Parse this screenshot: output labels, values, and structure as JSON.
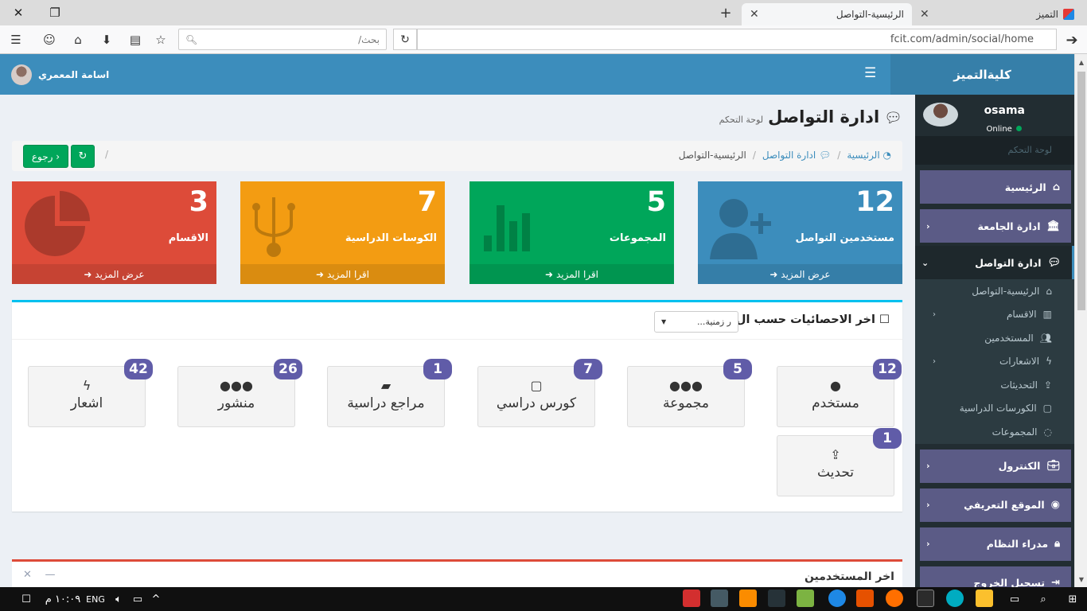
{
  "browser": {
    "tabs": [
      {
        "title": "الرئيسية-التواصل",
        "active": true
      },
      {
        "title": "التميز",
        "active": false
      }
    ],
    "search_placeholder": "بحث/",
    "url": "fcit.com/admin/social/home"
  },
  "header": {
    "logo": "كليةالتميز",
    "user_name": "اسامة المعمري"
  },
  "sidebar": {
    "user": {
      "name": "osama",
      "status": "Online"
    },
    "section_header": "لوحة التحكم",
    "items": [
      {
        "label": "الرئيسية",
        "icon": "home-icon"
      },
      {
        "label": "ادارة الجامعة",
        "icon": "bank-icon"
      },
      {
        "label": "ادارة التواصل",
        "icon": "comments-icon"
      },
      {
        "label": "الكنترول",
        "icon": "briefcase-icon"
      },
      {
        "label": "الموقع التعريفي",
        "icon": "globe-icon"
      },
      {
        "label": "مدراء النظام",
        "icon": "lock-icon"
      },
      {
        "label": "تسجيل الخروج",
        "icon": "sign-out-icon"
      }
    ],
    "subitems": [
      {
        "label": "الرئيسية-التواصل",
        "icon": "home-icon"
      },
      {
        "label": "الاقسام",
        "icon": "columns-icon"
      },
      {
        "label": "المستخدمين",
        "icon": "users-icon"
      },
      {
        "label": "الاشعارات",
        "icon": "bolt-icon"
      },
      {
        "label": "التحديثات",
        "icon": "upload-icon"
      },
      {
        "label": "الكورسات الدراسية",
        "icon": "sticky-note-icon"
      },
      {
        "label": "المجموعات",
        "icon": "comment-icon"
      }
    ]
  },
  "page": {
    "title": "ادارة التواصل",
    "subtitle": "لوحة التحكم",
    "breadcrumb": [
      "الرئيسية",
      "ادارة التواصل",
      "الرئيسية-التواصل"
    ],
    "back_label": "رجوع"
  },
  "boxes": [
    {
      "number": "12",
      "label": "مستخدمين التواصل",
      "link": "عرض المزيد",
      "color": "#3c8dbc"
    },
    {
      "number": "5",
      "label": "المجموعات",
      "link": "اقرا المزيد",
      "color": "#00a65a"
    },
    {
      "number": "7",
      "label": "الكوسات الدراسية",
      "link": "اقرا المزيد",
      "color": "#f39c12"
    },
    {
      "number": "3",
      "label": "الاقسام",
      "link": "عرض المزيد",
      "color": "#dd4b39"
    }
  ],
  "stats_panel": {
    "title": "اخر الاحصائيات حسب ال :",
    "period_value": "...ر زمنية",
    "stats": [
      {
        "count": "12",
        "label": "مستخدم",
        "icon": "user-icon"
      },
      {
        "count": "5",
        "label": "مجموعة",
        "icon": "users-icon"
      },
      {
        "count": "7",
        "label": "كورس دراسي",
        "icon": "sticky-note-icon"
      },
      {
        "count": "1",
        "label": "مراجع دراسية",
        "icon": "book-icon"
      },
      {
        "count": "26",
        "label": "منشور",
        "icon": "users-icon"
      },
      {
        "count": "42",
        "label": "اشعار",
        "icon": "bolt-icon"
      },
      {
        "count": "1",
        "label": "تحديث",
        "icon": "upload-icon"
      }
    ]
  },
  "users_panel": {
    "title": "اخر المستخدمين"
  },
  "taskbar": {
    "time": "١٠:٠٩ م",
    "lang": "ENG"
  }
}
